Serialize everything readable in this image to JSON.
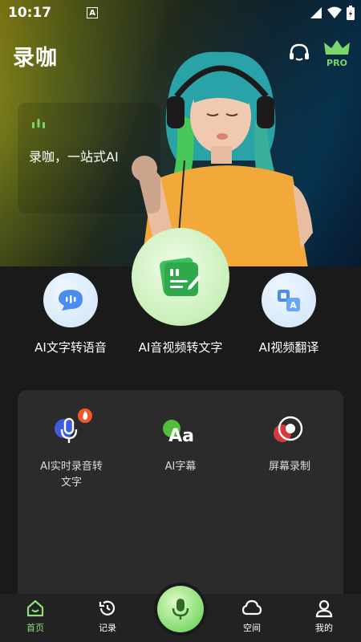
{
  "status_bar": {
    "time": "10:17",
    "notification_glyph": "A"
  },
  "header": {
    "title": "录咖",
    "pro_badge": "PRO"
  },
  "hero": {
    "slogan": "录咖，一站式AI"
  },
  "features": [
    {
      "label": "AI文字转语音",
      "icon": "chat-bubble-icon"
    },
    {
      "label": "AI音视频转文字",
      "icon": "document-edit-icon"
    },
    {
      "label": "AI视频翻译",
      "icon": "translate-icon"
    }
  ],
  "tools": [
    {
      "label": "AI实时录音转\n文字",
      "icon": "mic-fire-icon"
    },
    {
      "label": "AI字幕",
      "icon": "aa-icon"
    },
    {
      "label": "屏幕录制",
      "icon": "record-icon"
    }
  ],
  "nav": {
    "home": "首页",
    "records": "记录",
    "space": "空间",
    "mine": "我的"
  },
  "colors": {
    "accent": "#8fe07a",
    "card": "#2b2b2b",
    "background": "#1a1a1a"
  }
}
